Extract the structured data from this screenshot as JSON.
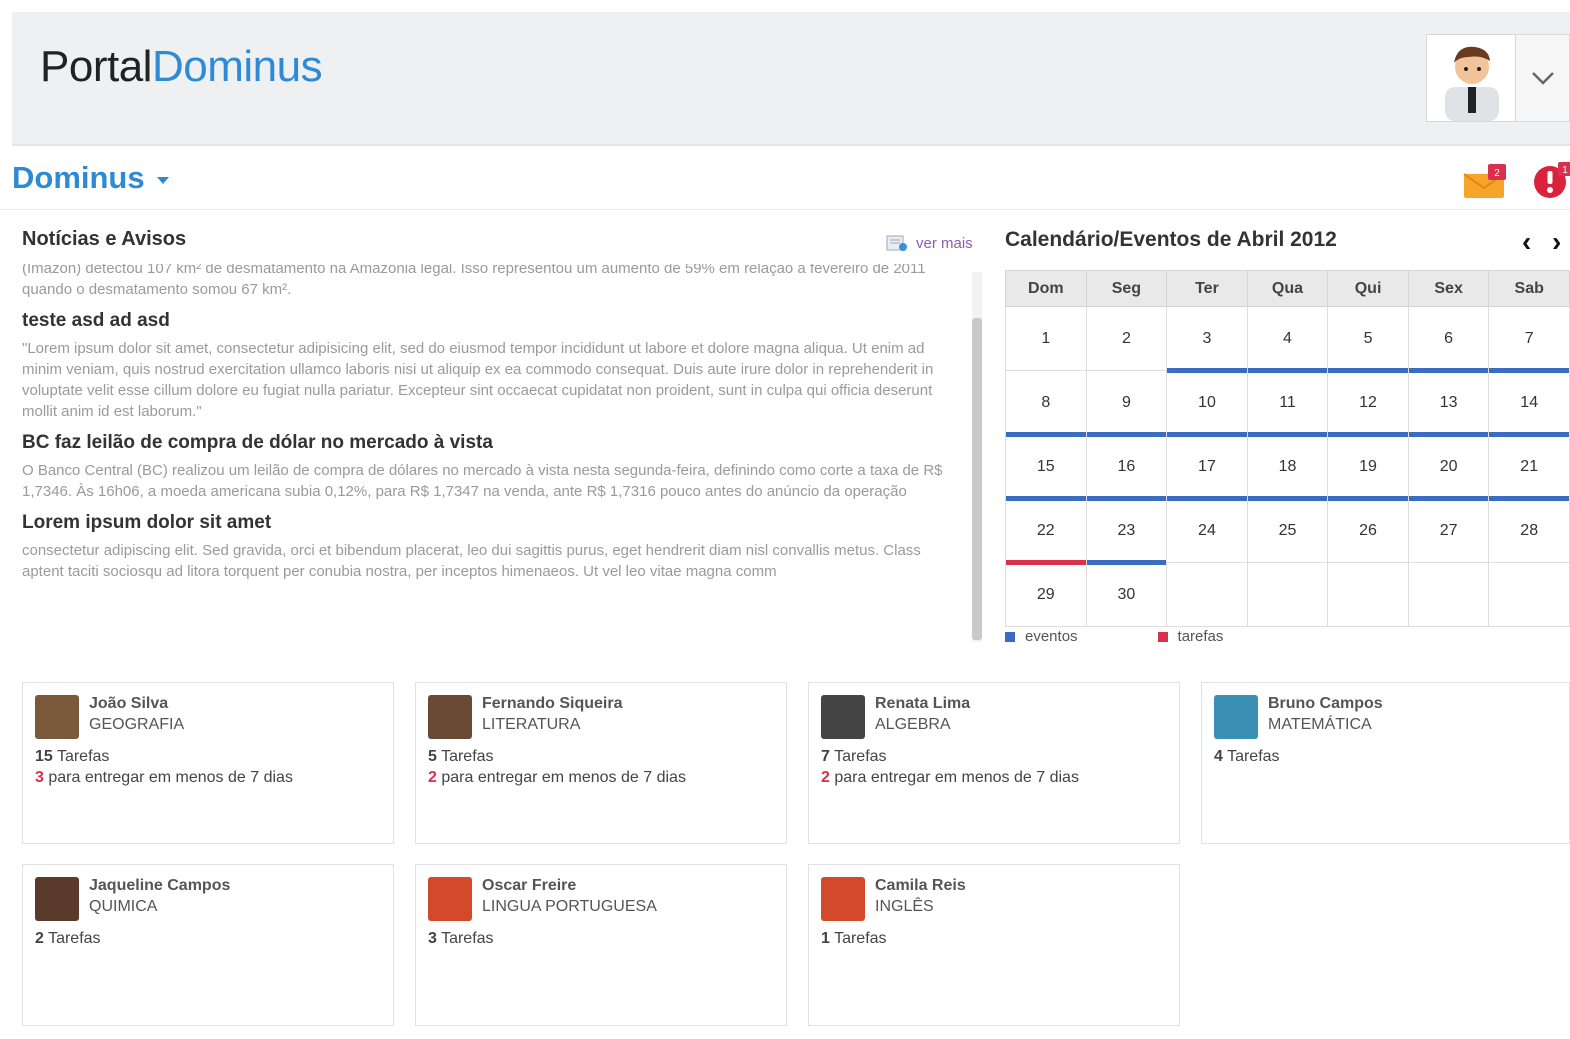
{
  "brand": {
    "part1": "Portal",
    "part2": "Dominus"
  },
  "nav": {
    "menu_label": "Dominus",
    "mail_count": "2",
    "alert_count": "1"
  },
  "news": {
    "title": "Notícias e Avisos",
    "more_label": "ver mais",
    "items": [
      {
        "headline": "",
        "body": "(Imazon) detectou 107 km² de desmatamento na Amazônia legal. Isso representou um aumento de 59% em relação a fevereiro de 2011 quando o desmatamento somou 67 km²."
      },
      {
        "headline": "teste asd ad asd",
        "body": "\"Lorem ipsum dolor sit amet, consectetur adipisicing elit, sed do eiusmod tempor incididunt ut labore et dolore magna aliqua. Ut enim ad minim veniam, quis nostrud exercitation ullamco laboris nisi ut aliquip ex ea commodo consequat. Duis aute irure dolor in reprehenderit in voluptate velit esse cillum dolore eu fugiat nulla pariatur. Excepteur sint occaecat cupidatat non proident, sunt in culpa qui officia deserunt mollit anim id est laborum.\""
      },
      {
        "headline": "BC faz leilão de compra de dólar no mercado à vista",
        "body": "O Banco Central (BC) realizou um leilão de compra de dólares no mercado à vista nesta segunda-feira, definindo como corte a taxa de R$ 1,7346. Às 16h06, a moeda americana subia 0,12%, para R$ 1,7347 na venda, ante R$ 1,7316 pouco antes do anúncio da operação"
      },
      {
        "headline": "Lorem ipsum dolor sit amet",
        "body": "consectetur adipiscing elit. Sed gravida, orci et bibendum placerat, leo dui sagittis purus, eget hendrerit diam nisl convallis metus. Class aptent taciti sociosqu ad litora torquent per conubia nostra, per inceptos himenaeos. Ut vel leo vitae magna comm"
      }
    ]
  },
  "calendar": {
    "title": "Calendário/Eventos de Abril 2012",
    "prev": "‹",
    "next": "›",
    "days": [
      "Dom",
      "Seg",
      "Ter",
      "Qua",
      "Qui",
      "Sex",
      "Sab"
    ],
    "weeks": [
      [
        "1",
        "2",
        "3",
        "4",
        "5",
        "6",
        "7"
      ],
      [
        "8",
        "9",
        "10",
        "11",
        "12",
        "13",
        "14"
      ],
      [
        "15",
        "16",
        "17",
        "18",
        "19",
        "20",
        "21"
      ],
      [
        "22",
        "23",
        "24",
        "25",
        "26",
        "27",
        "28"
      ],
      [
        "29",
        "30",
        "",
        "",
        "",
        "",
        ""
      ]
    ],
    "event_days": [
      "3",
      "4",
      "5",
      "6",
      "7",
      "8",
      "9",
      "10",
      "11",
      "12",
      "13",
      "14",
      "15",
      "16",
      "17",
      "18",
      "19",
      "20",
      "21",
      "23"
    ],
    "task_days": [
      "22"
    ],
    "legend": {
      "events": "eventos",
      "tasks": "tarefas",
      "events_color": "#3b6cc4",
      "tasks_color": "#d9304c"
    }
  },
  "teachers": [
    {
      "name": "João Silva",
      "subject": "GEOGRAFIA",
      "tasks_n": "15",
      "tasks_label": " Tarefas",
      "due_n": "3",
      "due_label": " para entregar em menos de 7 dias",
      "photo": "#7a5a3a"
    },
    {
      "name": "Fernando Siqueira",
      "subject": "LITERATURA",
      "tasks_n": "5",
      "tasks_label": " Tarefas",
      "due_n": "2",
      "due_label": " para entregar em menos de 7 dias",
      "photo": "#6b4a35"
    },
    {
      "name": "Renata Lima",
      "subject": "ALGEBRA",
      "tasks_n": "7",
      "tasks_label": " Tarefas",
      "due_n": "2",
      "due_label": " para entregar em menos de 7 dias",
      "photo": "#444444"
    },
    {
      "name": "Bruno Campos",
      "subject": "MATEMÁTICA",
      "tasks_n": "4",
      "tasks_label": " Tarefas",
      "due_n": "",
      "due_label": "",
      "photo": "#3a8fb5"
    },
    {
      "name": "Jaqueline Campos",
      "subject": "QUIMICA",
      "tasks_n": "2",
      "tasks_label": " Tarefas",
      "due_n": "",
      "due_label": "",
      "photo": "#5a3a2a"
    },
    {
      "name": "Oscar Freire",
      "subject": "LINGUA PORTUGUESA",
      "tasks_n": "3",
      "tasks_label": " Tarefas",
      "due_n": "",
      "due_label": "",
      "photo": "#d24a2a"
    },
    {
      "name": "Camila Reis",
      "subject": "INGLÊS",
      "tasks_n": "1",
      "tasks_label": " Tarefas",
      "due_n": "",
      "due_label": "",
      "photo": "#d24a2a"
    }
  ]
}
